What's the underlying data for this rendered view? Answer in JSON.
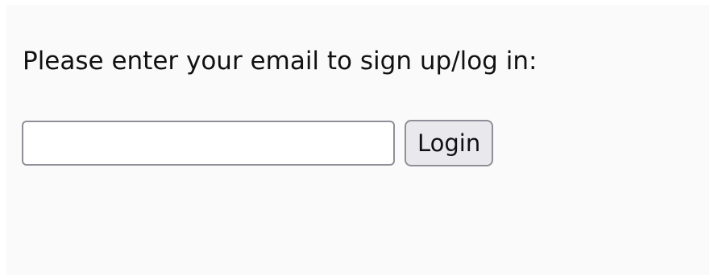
{
  "form": {
    "prompt": "Please enter your email to sign up/log in:",
    "email_value": "",
    "email_placeholder": "",
    "login_label": "Login"
  },
  "colors": {
    "panel_background": "#fafafa",
    "button_background": "#e9e9ed",
    "border": "#8f8f99",
    "text": "#111111"
  }
}
